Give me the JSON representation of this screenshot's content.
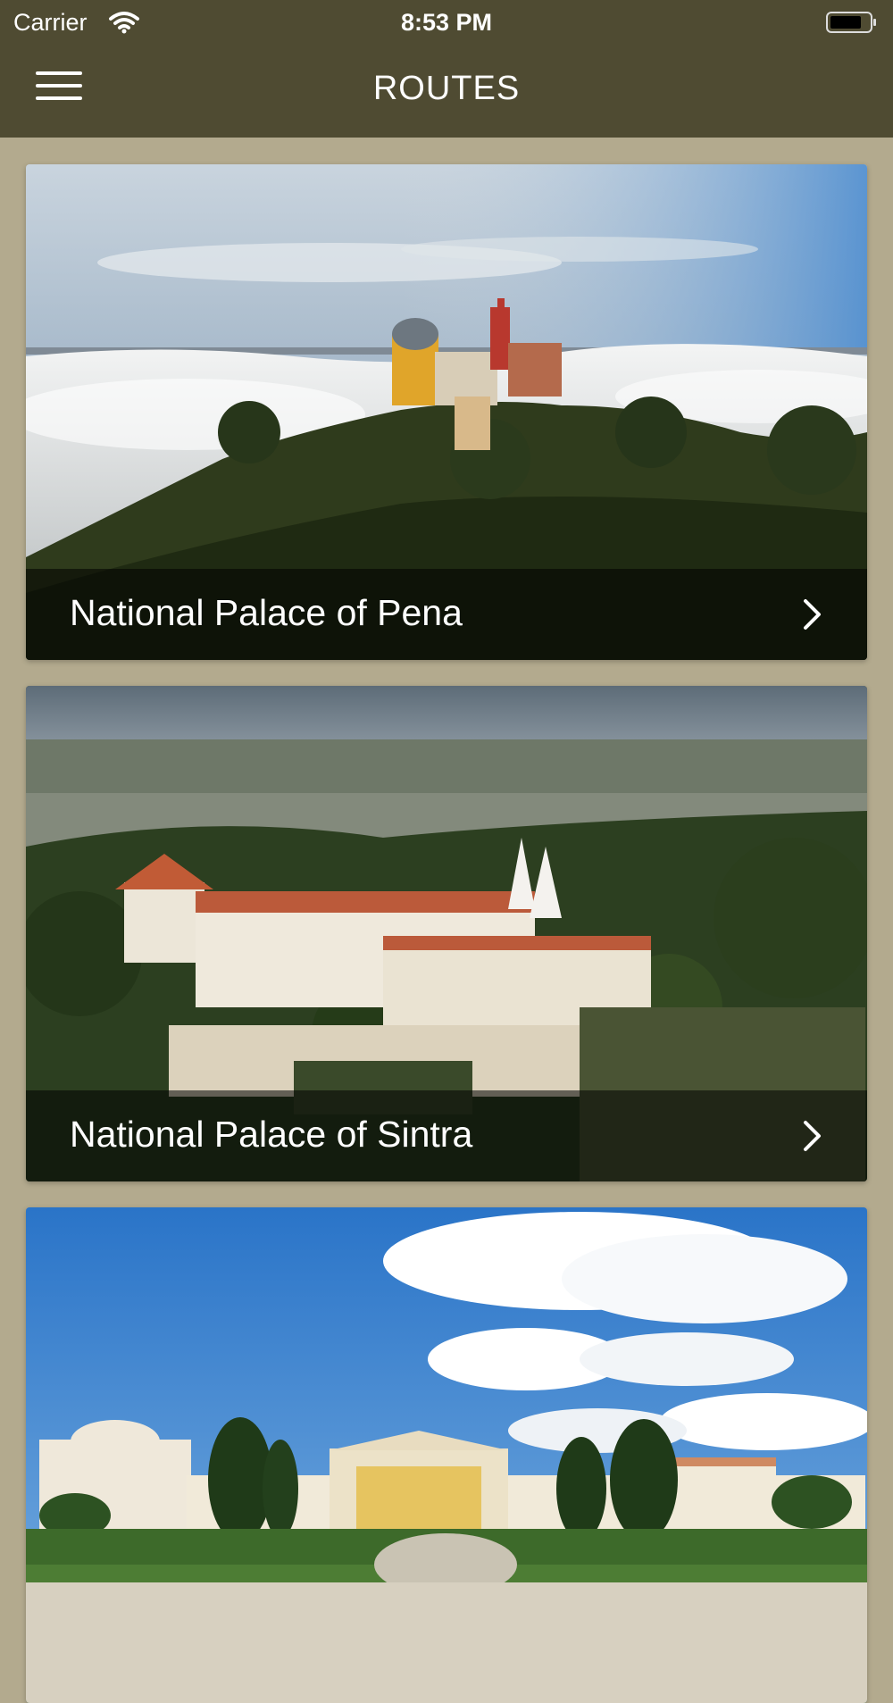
{
  "status_bar": {
    "carrier": "Carrier",
    "time": "8:53 PM"
  },
  "nav": {
    "title": "ROUTES",
    "menu_icon": "hamburger-menu-icon"
  },
  "routes": [
    {
      "name": "National Palace of Pena",
      "image": "pena-palace-photo"
    },
    {
      "name": "National Palace of Sintra",
      "image": "sintra-palace-photo"
    },
    {
      "name": "",
      "image": "queluz-palace-photo"
    }
  ],
  "colors": {
    "nav_background": "#4f4b32",
    "page_background": "#b3aa8e",
    "caption_overlay": "rgba(0,0,0,0.55)"
  }
}
